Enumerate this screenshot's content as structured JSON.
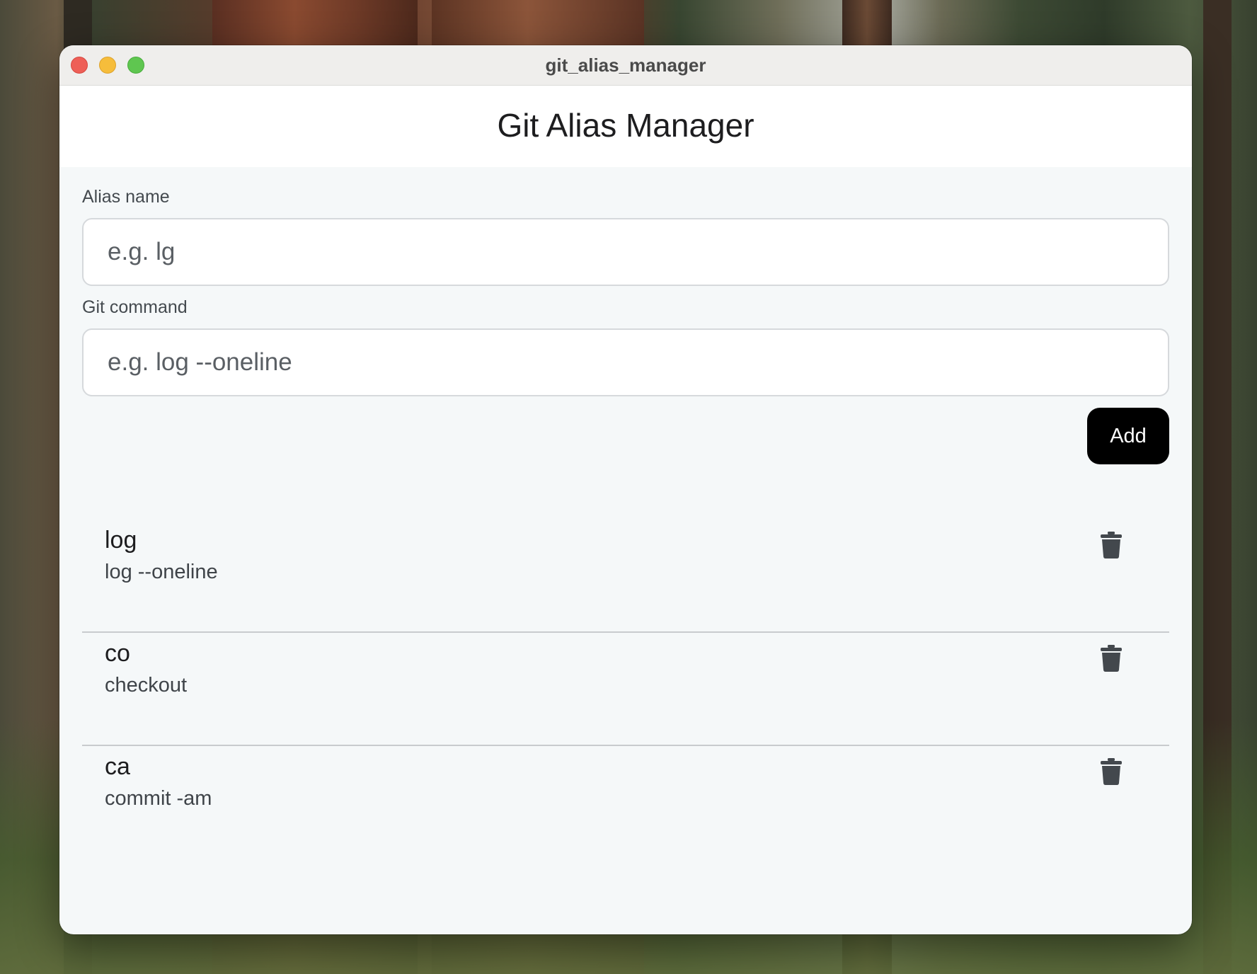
{
  "window": {
    "title": "git_alias_manager"
  },
  "app": {
    "title": "Git Alias Manager"
  },
  "form": {
    "alias_label": "Alias name",
    "alias_placeholder": "e.g. lg",
    "alias_value": "",
    "command_label": "Git command",
    "command_placeholder": "e.g. log --oneline",
    "command_value": "",
    "add_label": "Add"
  },
  "aliases": [
    {
      "name": "log",
      "command": "log --oneline"
    },
    {
      "name": "co",
      "command": "checkout"
    },
    {
      "name": "ca",
      "command": "commit -am"
    }
  ],
  "icons": {
    "delete": "trash-icon"
  },
  "colors": {
    "add_button_bg": "#000000",
    "content_bg": "#f5f8f9",
    "icon_color": "#43484d"
  }
}
